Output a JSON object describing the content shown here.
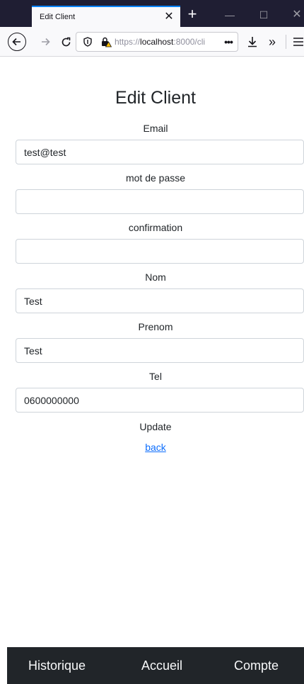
{
  "browser": {
    "tab_title": "Edit Client",
    "tab_close": "✕",
    "new_tab": "+",
    "url_prefix": "https://",
    "url_host": "localhost",
    "url_rest": ":8000/cli",
    "url_more": "•••",
    "overflow": "»"
  },
  "form": {
    "title": "Edit Client",
    "fields": [
      {
        "label": "Email",
        "value": "test@test"
      },
      {
        "label": "mot de passe",
        "value": ""
      },
      {
        "label": "confirmation",
        "value": ""
      },
      {
        "label": "Nom",
        "value": "Test"
      },
      {
        "label": "Prenom",
        "value": "Test"
      },
      {
        "label": "Tel",
        "value": "0600000000"
      }
    ],
    "update_label": "Update",
    "back_label": "back"
  },
  "bottom_nav": {
    "items": [
      "Historique",
      "Accueil",
      "Compte"
    ]
  },
  "colors": {
    "accent": "#0a84ff",
    "link": "#0d6efd",
    "bottom_nav_bg": "#212529",
    "tabstrip_bg": "#1f1e33"
  }
}
